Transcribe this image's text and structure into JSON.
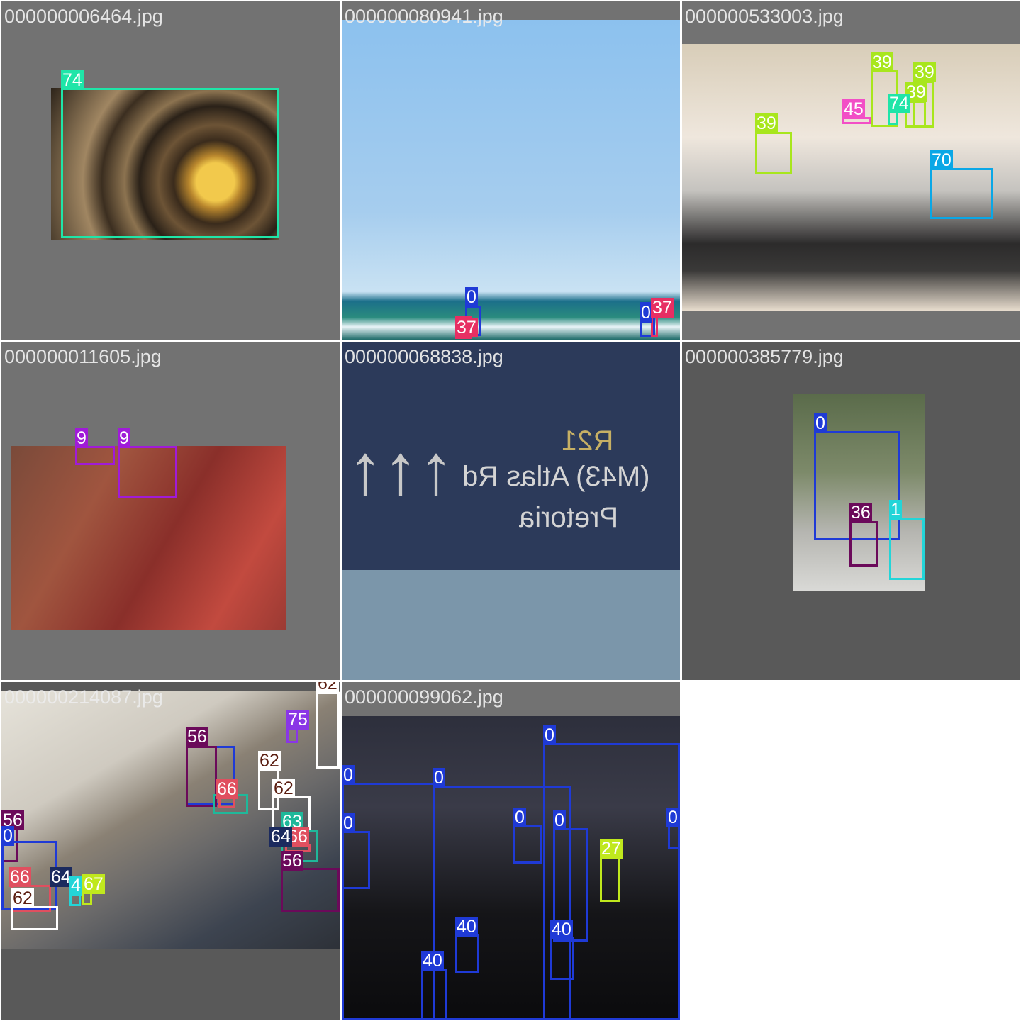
{
  "grid": {
    "cells": [
      {
        "filename": "000000006464.jpg",
        "labels": [
          "74"
        ]
      },
      {
        "filename": "000000080941.jpg",
        "labels": [
          "0",
          "0",
          "37",
          "37"
        ]
      },
      {
        "filename": "000000533003.jpg",
        "labels": [
          "39",
          "39",
          "39",
          "39",
          "45",
          "74",
          "70"
        ]
      },
      {
        "filename": "000000011605.jpg",
        "labels": [
          "9",
          "9"
        ]
      },
      {
        "filename": "000000068838.jpg",
        "labels": []
      },
      {
        "filename": "000000385779.jpg",
        "labels": [
          "0",
          "36",
          "1"
        ]
      },
      {
        "filename": "000000214087.jpg",
        "labels": [
          "62",
          "75",
          "56",
          "62",
          "66",
          "62",
          "63",
          "66",
          "64",
          "56",
          "56",
          "0",
          "66",
          "64",
          "4",
          "67",
          "62"
        ]
      },
      {
        "filename": "000000099062.jpg",
        "labels": [
          "0",
          "0",
          "0",
          "0",
          "0",
          "0",
          "0",
          "27",
          "40",
          "40",
          "40"
        ]
      }
    ]
  },
  "sign_text": {
    "line1": "R21",
    "line2": "(M43) Atlas Rd",
    "line3": "Pretoria"
  },
  "colors": {
    "person": "#1f3ad6",
    "car": "#23d5d8",
    "surfboard": "#e72f63",
    "bottle": "#a8e61d",
    "cup": "#0b4fd6",
    "bowl": "#f24fc6",
    "clock": "#1fe5a8",
    "microwave": "#0aa7e6",
    "traffic_light": "#a01bd8",
    "laptop": "#ffffff",
    "chair": "#6b0a5a",
    "tv": "#1fb89a",
    "keyboard": "#1b2a5e",
    "mouse": "#e04f5f",
    "vase": "#8a36e6",
    "remote": "#c0e81d",
    "cell_phone": "#c0e81d"
  }
}
